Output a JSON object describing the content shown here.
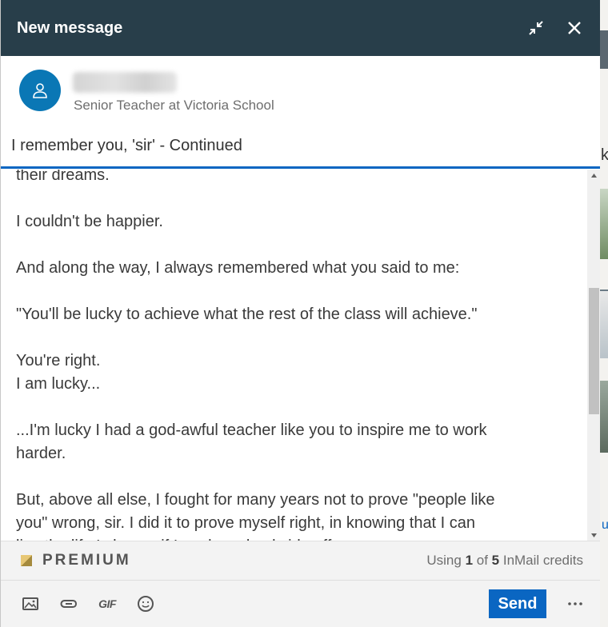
{
  "background": {
    "letter_right": "k",
    "letter_right2": "u"
  },
  "header": {
    "title": "New message",
    "minimize_icon": "minimize-arrows-icon",
    "close_icon": "close-icon"
  },
  "recipient": {
    "name": "Tina Lancia",
    "headline": "Senior Teacher at Victoria School",
    "avatar_icon": "person-icon"
  },
  "subject": "I remember you, 'sir' - Continued",
  "body_lines": [
    "their dreams.",
    "",
    "I couldn't be happier.",
    "",
    "And along the way, I always remembered what you said to me:",
    "",
    "\"You'll be lucky to achieve what the rest of the class will achieve.\"",
    "",
    "You're right.",
    "I am lucky...",
    "",
    "...I'm lucky I had a god-awful teacher like you to inspire me to work",
    "harder.",
    "",
    "But, above all else, I fought for many years not to prove \"people like",
    "you\" wrong, sir. I did it to prove myself right, in knowing that I can",
    "live the life I choose if I work my backside off."
  ],
  "premium": {
    "label": "PREMIUM",
    "credits_prefix": "Using ",
    "credits_used": "1",
    "credits_of": " of ",
    "credits_total": "5",
    "credits_suffix": " InMail credits"
  },
  "toolbar": {
    "icons": [
      "image-icon",
      "attachment-icon",
      "gif-icon",
      "emoji-icon"
    ],
    "gif_label": "GIF",
    "send_label": "Send",
    "more_label": "···"
  },
  "colors": {
    "header_bg": "#283e4a",
    "accent": "#0a66c2",
    "avatar_bg": "#0a77b5",
    "premium_gold": "#e7c775"
  }
}
